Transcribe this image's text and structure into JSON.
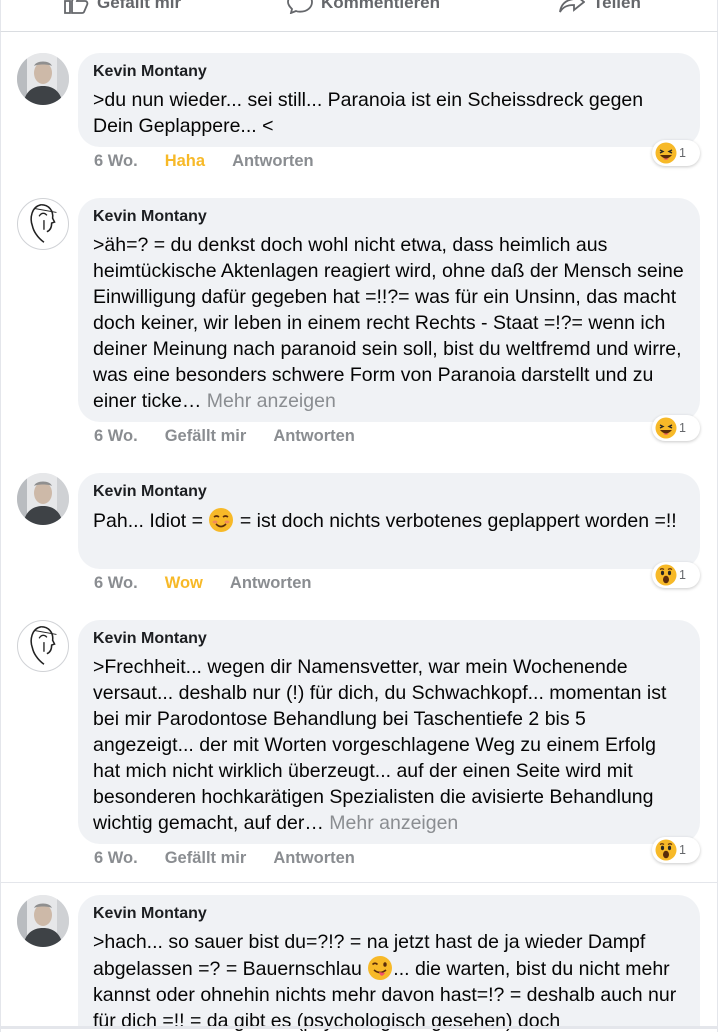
{
  "actions": {
    "like_label": "Gefällt mir",
    "comment_label": "Kommentieren",
    "share_label": "Teilen"
  },
  "comments": [
    {
      "author": "Kevin Montany",
      "avatar": "photo",
      "text": ">du nun wieder... sei still... Paranoia ist ein Scheissdreck gegen Dein Geplappere... <",
      "time": "6 Wo.",
      "reaction_label": "Haha",
      "reply_label": "Antworten",
      "reaction_emoji": "laughing-emoji",
      "reaction_count": "1"
    },
    {
      "author": "Kevin Montany",
      "avatar": "sketch",
      "text": ">äh=? = du denkst doch wohl nicht etwa, dass heimlich aus heimtückische Aktenlagen reagiert wird, ohne daß der Mensch seine Einwilligung dafür gegeben hat =!!?= was für ein Unsinn, das macht doch keiner, wir leben in einem recht Rechts - Staat =!?= wenn ich deiner Meinung nach paranoid sein soll, bist du weltfremd und wirre, was eine besonders schwere Form von Paranoia darstellt und zu einer ticke…",
      "more_label": "Mehr anzeigen",
      "time": "6 Wo.",
      "reaction_label": "Gefällt mir",
      "reply_label": "Antworten",
      "reaction_emoji": "laughing-emoji",
      "reaction_count": "1"
    },
    {
      "author": "Kevin Montany",
      "avatar": "photo",
      "text_before": "Pah... Idiot = ",
      "inline_emoji": "smiling-emoji",
      "text_after": " = ist doch nichts verbotenes geplappert worden =!!",
      "time": "6 Wo.",
      "reaction_label": "Wow",
      "reply_label": "Antworten",
      "reaction_emoji": "wow-emoji",
      "reaction_count": "1"
    },
    {
      "author": "Kevin Montany",
      "avatar": "sketch",
      "text": ">Frechheit... wegen dir Namensvetter, war mein Wochenende versaut... deshalb nur (!) für dich, du Schwachkopf... momentan ist bei mir Parodontose Behandlung bei Taschentiefe 2 bis 5 angezeigt... der mit Worten vorgeschlagene Weg zu einem Erfolg hat mich nicht wirklich überzeugt... auf der einen Seite wird mit besonderen hochkarätigen Spezialisten  die avisierte Behandlung wichtig gemacht, auf der…",
      "more_label": "Mehr anzeigen",
      "time": "6 Wo.",
      "reaction_label": "Gefällt mir",
      "reply_label": "Antworten",
      "reaction_emoji": "wow-emoji",
      "reaction_count": "1"
    },
    {
      "author": "Kevin Montany",
      "avatar": "photo",
      "text_before": ">hach... so sauer bist du=?!? = na jetzt hast de ja wieder Dampf abgelassen =? = Bauernschlau ",
      "inline_emoji": "winking-tongue-emoji",
      "text_after": "... die warten, bist du nicht mehr kannst oder ohnehin nichts mehr davon hast=!? = deshalb auch nur für dich =!! = da gibt es (psychologisch gesehen) doch"
    }
  ],
  "colors": {
    "bubble": "#f0f2f5",
    "meta_text": "#8a8d91",
    "reaction_active": "#f7b928",
    "text": "#050505"
  }
}
